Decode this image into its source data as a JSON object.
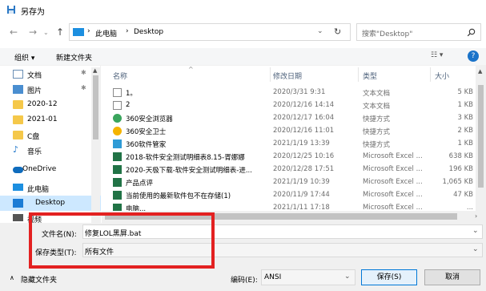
{
  "window": {
    "title": "另存为"
  },
  "address": {
    "breadcrumb": [
      "此电脑",
      "Desktop"
    ],
    "search_placeholder": "搜索\"Desktop\""
  },
  "toolbar": {
    "organize": "组织 ▾",
    "new_folder": "新建文件夹"
  },
  "nav": {
    "items": [
      {
        "label": "文档",
        "pinned": true,
        "kind": "doc"
      },
      {
        "label": "图片",
        "pinned": true,
        "kind": "pic"
      },
      {
        "label": "2020-12",
        "pinned": false,
        "kind": "folder"
      },
      {
        "label": "2021-01",
        "pinned": false,
        "kind": "folder"
      },
      {
        "label": "C盘",
        "pinned": false,
        "kind": "folder"
      },
      {
        "label": "音乐",
        "pinned": false,
        "kind": "music"
      },
      {
        "label": "OneDrive",
        "pinned": false,
        "kind": "cloud"
      },
      {
        "label": "此电脑",
        "pinned": false,
        "kind": "pc"
      },
      {
        "label": "Desktop",
        "pinned": false,
        "kind": "desktop",
        "selected": true
      },
      {
        "label": "视频",
        "pinned": false,
        "kind": "video"
      }
    ]
  },
  "columns": {
    "name": "名称",
    "date": "修改日期",
    "type": "类型",
    "size": "大小"
  },
  "files": [
    {
      "name": "1。",
      "date": "2020/3/31 9:31",
      "type": "文本文档",
      "size": "5 KB",
      "icon": "txt"
    },
    {
      "name": "2",
      "date": "2020/12/16 14:14",
      "type": "文本文档",
      "size": "1 KB",
      "icon": "txt"
    },
    {
      "name": "360安全浏览器",
      "date": "2020/12/17 16:04",
      "type": "快捷方式",
      "size": "3 KB",
      "icon": "browser"
    },
    {
      "name": "360安全卫士",
      "date": "2020/12/16 11:01",
      "type": "快捷方式",
      "size": "2 KB",
      "icon": "guard"
    },
    {
      "name": "360软件管家",
      "date": "2021/1/19 13:39",
      "type": "快捷方式",
      "size": "1 KB",
      "icon": "manager"
    },
    {
      "name": "2018-软件安全测试明细表8.15-胥娜娜",
      "date": "2020/12/25 10:16",
      "type": "Microsoft Excel ...",
      "size": "638 KB",
      "icon": "xls"
    },
    {
      "name": "2020-天极下载-软件安全测试明细表-进...",
      "date": "2020/12/28 17:51",
      "type": "Microsoft Excel ...",
      "size": "196 KB",
      "icon": "xls"
    },
    {
      "name": "产品点评",
      "date": "2021/1/19 10:39",
      "type": "Microsoft Excel ...",
      "size": "1,065 KB",
      "icon": "xls"
    },
    {
      "name": "当前使用的最新软件包不在存储(1)",
      "date": "2020/11/9 17:44",
      "type": "Microsoft Excel ...",
      "size": "47 KB",
      "icon": "xls"
    },
    {
      "name": "电脑...",
      "date": "2021/1/11 17:18",
      "type": "Microsoft Excel ...",
      "size": "...",
      "icon": "xls"
    }
  ],
  "form": {
    "filename_label": "文件名(N):",
    "filename_value": "修复LOL黑屏.bat",
    "type_label": "保存类型(T):",
    "type_value": "所有文件"
  },
  "bottom": {
    "hide_folders": "隐藏文件夹",
    "encoding_label": "编码(E):",
    "encoding_value": "ANSI",
    "save": "保存(S)",
    "cancel": "取消"
  },
  "colors": {
    "selection": "#cde8ff",
    "accent": "#0078d7",
    "highlight_box": "#e32121"
  }
}
